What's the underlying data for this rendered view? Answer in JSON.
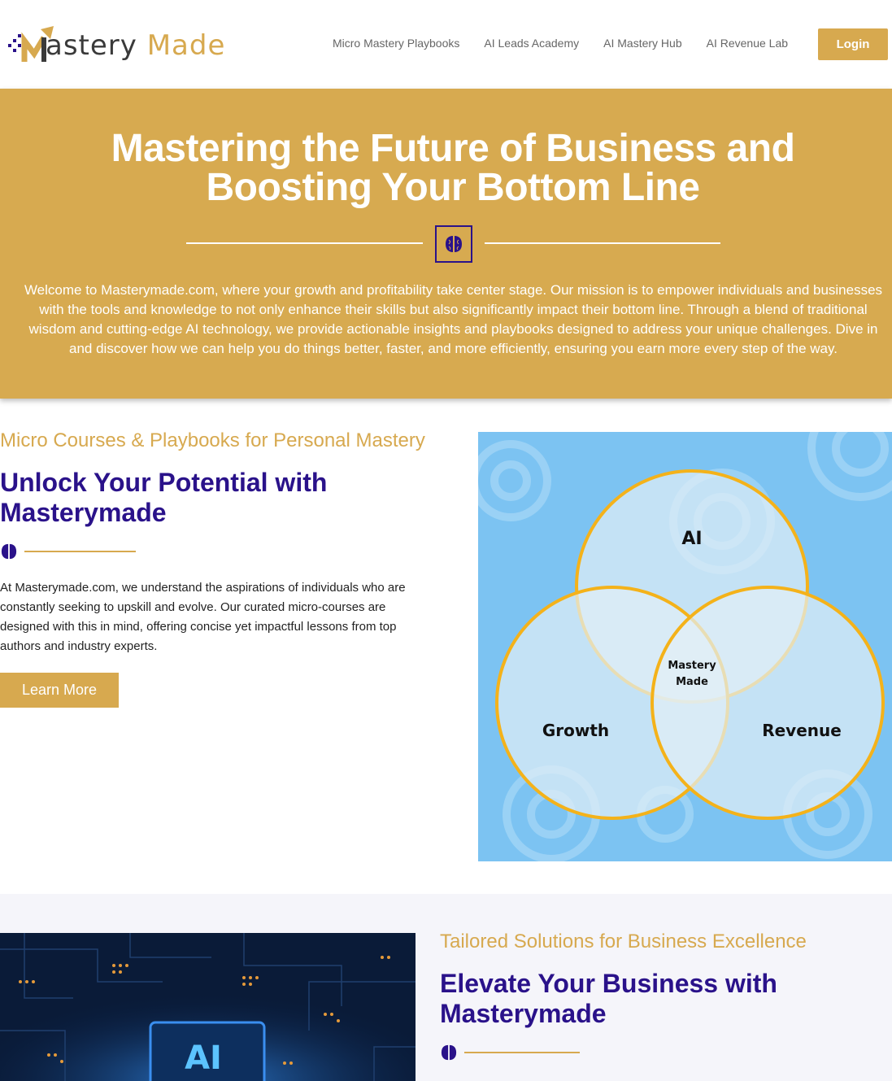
{
  "header": {
    "logo": {
      "word1": "astery",
      "word2": "Made",
      "initial": "M"
    },
    "nav": [
      "Micro Mastery Playbooks",
      "AI Leads Academy",
      "AI Mastery Hub",
      "AI Revenue Lab"
    ],
    "login_label": "Login"
  },
  "hero": {
    "title_line1": "Mastering the Future of Business and",
    "title_line2": "Boosting Your Bottom Line",
    "body_lines": [
      "Welcome to Masterymade.com, where your growth and profitability take center stage. Our mission is to empower individuals and businesses",
      "with the tools and knowledge to not only enhance their skills but also significantly impact their bottom line. Through a blend of traditional",
      "wisdom and cutting-edge AI technology, we provide actionable insights and playbooks designed to address your unique challenges. Dive in",
      "and discover how we can help you do things better, faster, and more efficiently, ensuring you earn more every step of the way."
    ]
  },
  "section1": {
    "kicker": "Micro Courses & Playbooks for Personal Mastery",
    "title_line1": "Unlock Your Potential with",
    "title_line2": "Masterymade",
    "body_lines": [
      "At Masterymade.com, we understand the aspirations of individuals who are",
      "constantly seeking to upskill and evolve. Our curated micro-courses are",
      "designed with this in mind, offering concise yet impactful lessons from top",
      "authors and industry experts."
    ],
    "button_label": "Learn More",
    "venn": {
      "top": "AI",
      "left": "Growth",
      "right": "Revenue",
      "center_line1": "Mastery",
      "center_line2": "Made"
    }
  },
  "section2": {
    "kicker": "Tailored Solutions for Business Excellence",
    "title_line1": "Elevate Your Business with",
    "title_line2": "Masterymade",
    "image_label": "AI"
  },
  "colors": {
    "gold": "#d7a94f",
    "navy": "#2a128a",
    "sky": "#7cc3f2",
    "ring": "#f4b21a"
  }
}
